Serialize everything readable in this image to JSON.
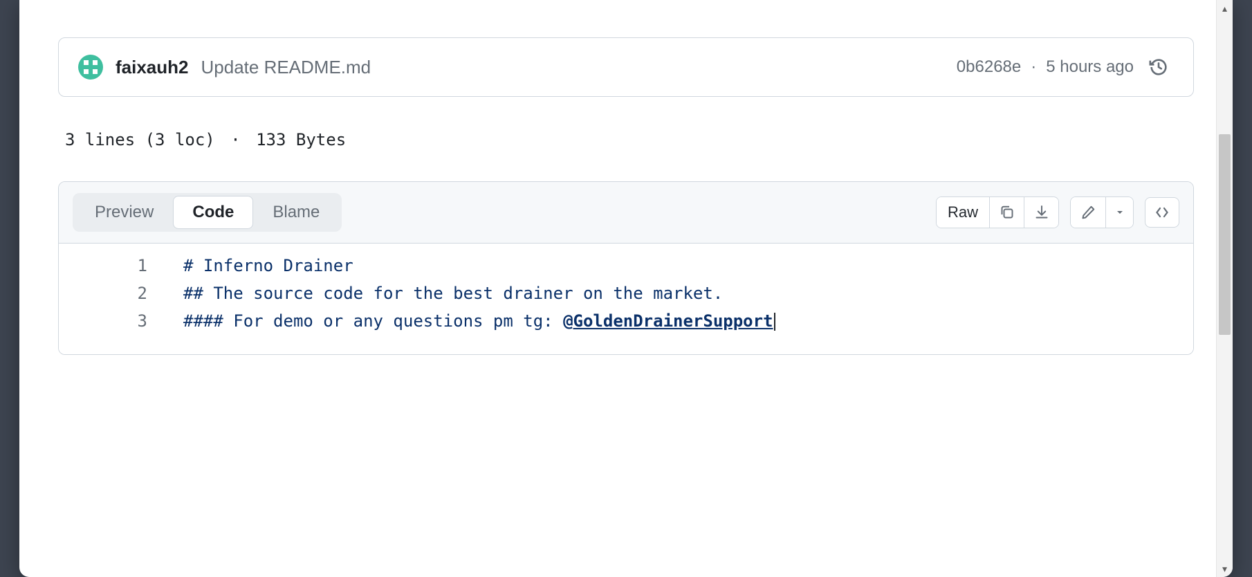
{
  "commit": {
    "author": "faixauh2",
    "message": "Update README.md",
    "sha": "0b6268e",
    "sep": "·",
    "time": "5 hours ago"
  },
  "file_stats": {
    "lines": "3 lines (3 loc)",
    "dot": "·",
    "size": "133 Bytes"
  },
  "tabs": {
    "preview": "Preview",
    "code": "Code",
    "blame": "Blame"
  },
  "toolbar": {
    "raw": "Raw"
  },
  "code": {
    "lines": [
      {
        "n": "1",
        "text": "# Inferno Drainer"
      },
      {
        "n": "2",
        "text": "## The source code for the best drainer on the market."
      },
      {
        "n": "3",
        "prefix": "#### For demo or any questions pm tg: ",
        "at": "@",
        "link": "GoldenDrainerSupport"
      }
    ]
  }
}
